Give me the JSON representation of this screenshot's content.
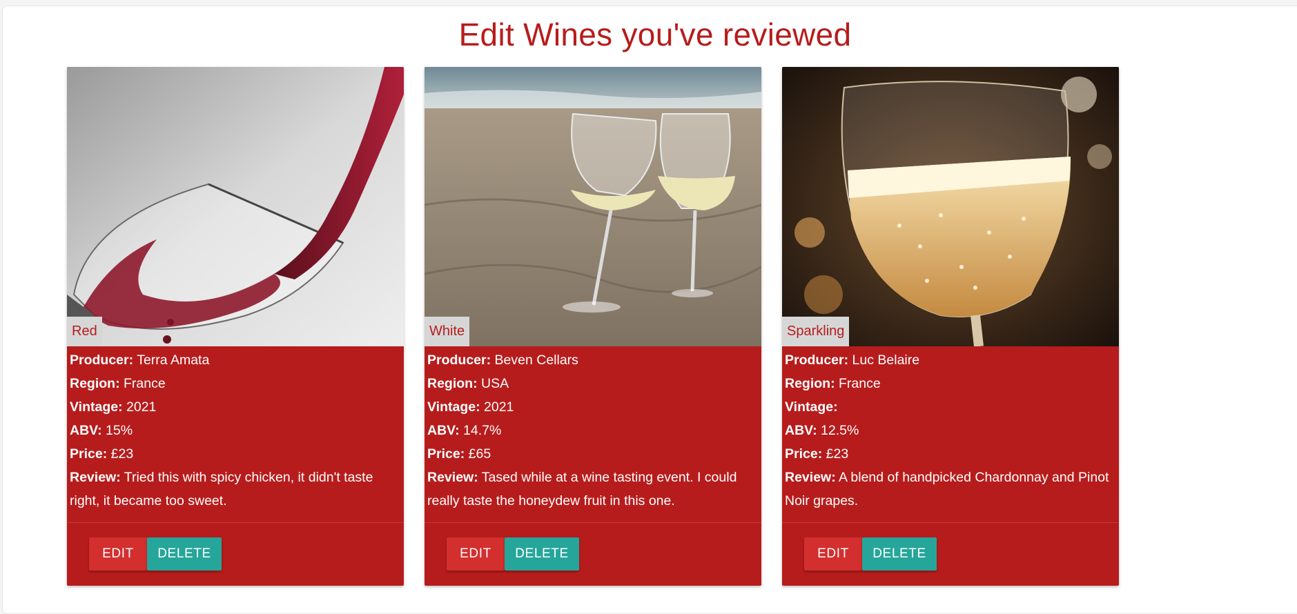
{
  "page": {
    "title": "Edit Wines you've reviewed"
  },
  "labels": {
    "producer": "Producer:",
    "region": "Region:",
    "vintage": "Vintage:",
    "abv": "ABV:",
    "price": "Price:",
    "review": "Review:",
    "edit": "Edit",
    "delete": "Delete"
  },
  "colors": {
    "accent": "#b71c1c",
    "edit": "#d32f2f",
    "delete": "#26a69a"
  },
  "wines": [
    {
      "type": "Red",
      "image": "red-wine-pouring-into-glass",
      "producer": "Terra Amata",
      "region": "France",
      "vintage": "2021",
      "abv": "15%",
      "price": "£23",
      "review": "Tried this with spicy chicken, it didn't taste right, it became too sweet."
    },
    {
      "type": "White",
      "image": "two-wine-glasses-on-beach",
      "producer": "Beven Cellars",
      "region": "USA",
      "vintage": "2021",
      "abv": "14.7%",
      "price": "£65",
      "review": "Tased while at a wine tasting event. I could really taste the honeydew fruit in this one."
    },
    {
      "type": "Sparkling",
      "image": "sparkling-wine-glass",
      "producer": "Luc Belaire",
      "region": "France",
      "vintage": "",
      "abv": "12.5%",
      "price": "£23",
      "review": "A blend of handpicked Chardonnay and Pinot Noir grapes."
    }
  ]
}
